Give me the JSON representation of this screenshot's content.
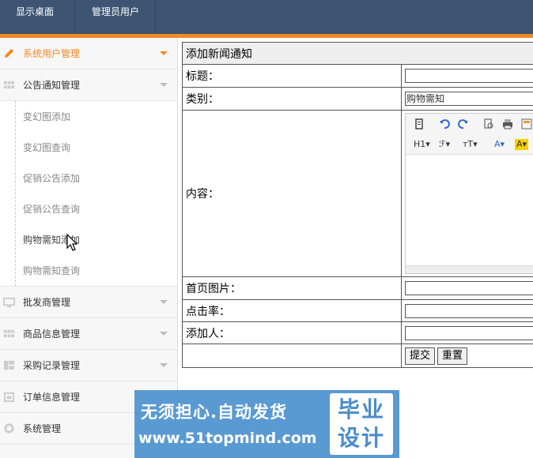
{
  "topbar": {
    "tabs": [
      "显示桌面",
      "管理员用户"
    ]
  },
  "sidebar": {
    "items": [
      {
        "label": "系统用户管理",
        "icon": "pencil-icon"
      },
      {
        "label": "公告通知管理",
        "icon": "grid-icon"
      },
      {
        "label": "批发商管理",
        "icon": "monitor-icon"
      },
      {
        "label": "商品信息管理",
        "icon": "grid-icon"
      },
      {
        "label": "采购记录管理",
        "icon": "layout-icon"
      },
      {
        "label": "订单信息管理",
        "icon": "calendar-icon"
      },
      {
        "label": "系统管理",
        "icon": "gear-icon"
      }
    ],
    "submenu": [
      "变幻图添加",
      "变幻图查询",
      "促销公告添加",
      "促销公告查询",
      "购物需知添加",
      "购物需知查询"
    ]
  },
  "form": {
    "title": "添加新闻通知",
    "labels": {
      "title": "标题：",
      "category": "类别：",
      "content": "内容：",
      "image": "首页图片：",
      "click_rate": "点击率：",
      "author": "添加人："
    },
    "values": {
      "title": "",
      "category": "购物需知",
      "image": "",
      "click_rate": "",
      "author": ""
    },
    "editor_toolbar": {
      "heading": "H1",
      "font": "ℱ",
      "size": "ᴛT",
      "font_color": "A",
      "highlight": "A"
    },
    "buttons": {
      "submit": "提交",
      "reset": "重置"
    }
  },
  "banner": {
    "line1": "无须担心.自动发货",
    "line2": "www.51topmind.com",
    "badge_line1": "毕业",
    "badge_line2": "设计"
  },
  "colors": {
    "accent": "#f08a24",
    "topbar": "#3d5472",
    "banner": "#5a9ad2"
  }
}
